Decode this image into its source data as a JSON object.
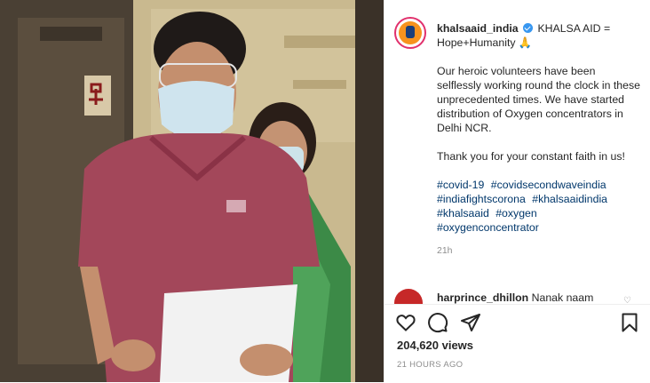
{
  "post": {
    "username": "khalsaaid_india",
    "headline": "KHALSA AID = Hope+Humanity 🙏",
    "paragraph1": "Our heroic volunteers have been selflessly working round the clock in these unprecedented times. We have started distribution of Oxygen concentrators in Delhi NCR.",
    "paragraph2": "Thank you for your constant faith in us!",
    "hashtags": [
      "#covid-19",
      "#covidsecondwaveindia",
      "#indiafightscorona",
      "#khalsaaidindia",
      "#khalsaaid",
      "#oxygen",
      "#oxygenconcentrator"
    ],
    "relative_time": "21h"
  },
  "comment": {
    "username": "harprince_dhillon",
    "text": "Nanak naam"
  },
  "stats": {
    "views": "204,620 views",
    "posted_ago": "21 HOURS AGO"
  },
  "icons": {
    "like": "heart-icon",
    "comment": "comment-icon",
    "share": "share-icon",
    "save": "bookmark-icon"
  },
  "colors": {
    "link": "#00376b",
    "verified": "#3897f0",
    "muted": "#8e8e8e"
  }
}
